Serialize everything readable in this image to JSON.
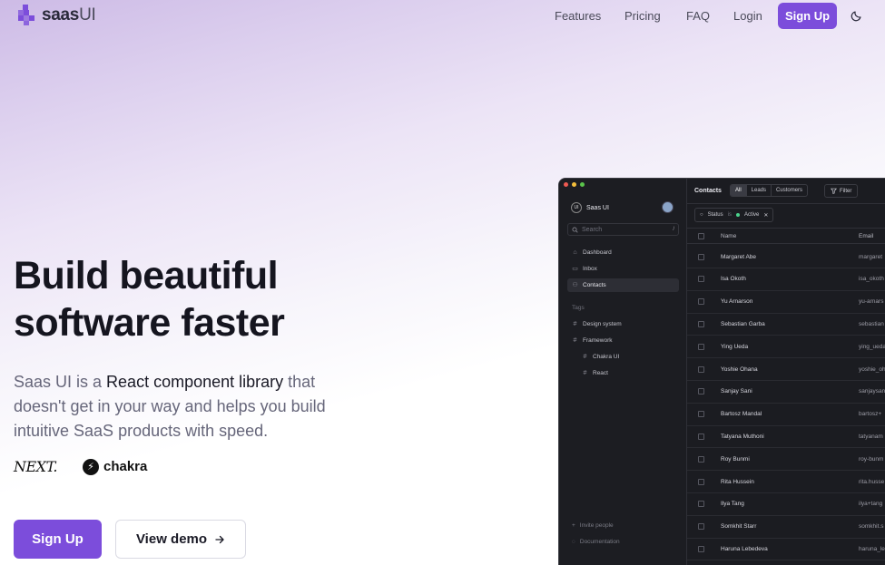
{
  "header": {
    "logo_bold": "saas",
    "logo_light": "UI",
    "nav": [
      "Features",
      "Pricing",
      "FAQ",
      "Login"
    ],
    "signup_label": "Sign Up"
  },
  "hero": {
    "title_line1": "Build beautiful",
    "title_line2": "software faster",
    "sub_prefix": "Saas UI is a ",
    "sub_emphasis": "React component library",
    "sub_rest": "that doesn't get in your way and helps you build intuitive SaaS products with speed.",
    "brand_next": "NEXT.",
    "brand_chakra": "chakra",
    "primary_cta": "Sign Up",
    "secondary_cta": "View demo"
  },
  "colors": {
    "accent": "#7c4ddb",
    "dark_bg": "#1b1c21"
  },
  "app": {
    "workspace": "Saas UI",
    "workspace_badge": "UI",
    "search_placeholder": "Search",
    "search_kbd": "/",
    "nav_items": [
      {
        "icon": "home-icon",
        "label": "Dashboard"
      },
      {
        "icon": "inbox-icon",
        "label": "Inbox"
      },
      {
        "icon": "users-icon",
        "label": "Contacts",
        "active": true
      }
    ],
    "tags_label": "Tags",
    "tags": [
      {
        "label": "Design system",
        "indent": false
      },
      {
        "label": "Framework",
        "indent": false
      },
      {
        "label": "Chakra UI",
        "indent": true
      },
      {
        "label": "React",
        "indent": true
      }
    ],
    "footer": [
      "Invite people",
      "Documentation"
    ],
    "page_title": "Contacts",
    "segments": [
      "All",
      "Leads",
      "Customers"
    ],
    "filter_label": "Filter",
    "filter_chip": {
      "field": "Status",
      "op": "is",
      "value": "Active"
    },
    "columns": [
      "Name",
      "Email"
    ],
    "rows": [
      {
        "name": "Margaret Abe",
        "email": "margaret"
      },
      {
        "name": "Isa Okoth",
        "email": "isa_okoth"
      },
      {
        "name": "Yu Arnarson",
        "email": "yu-arnars"
      },
      {
        "name": "Sebastian Garba",
        "email": "sebastian"
      },
      {
        "name": "Ying Ueda",
        "email": "ying_ueda"
      },
      {
        "name": "Yoshie Ohana",
        "email": "yoshie_oh"
      },
      {
        "name": "Sanjay Sani",
        "email": "sanjaysan"
      },
      {
        "name": "Bartosz Mandal",
        "email": "bartosz+"
      },
      {
        "name": "Tatyana Muthoni",
        "email": "tatyanam"
      },
      {
        "name": "Roy Bunmi",
        "email": "roy-bunm"
      },
      {
        "name": "Rita Hussein",
        "email": "rita.husse"
      },
      {
        "name": "Ilya Tang",
        "email": "ilya+tang"
      },
      {
        "name": "Somkhit Starr",
        "email": "somkhit.s"
      },
      {
        "name": "Haruna Lebedeva",
        "email": "haruna_le"
      }
    ]
  }
}
